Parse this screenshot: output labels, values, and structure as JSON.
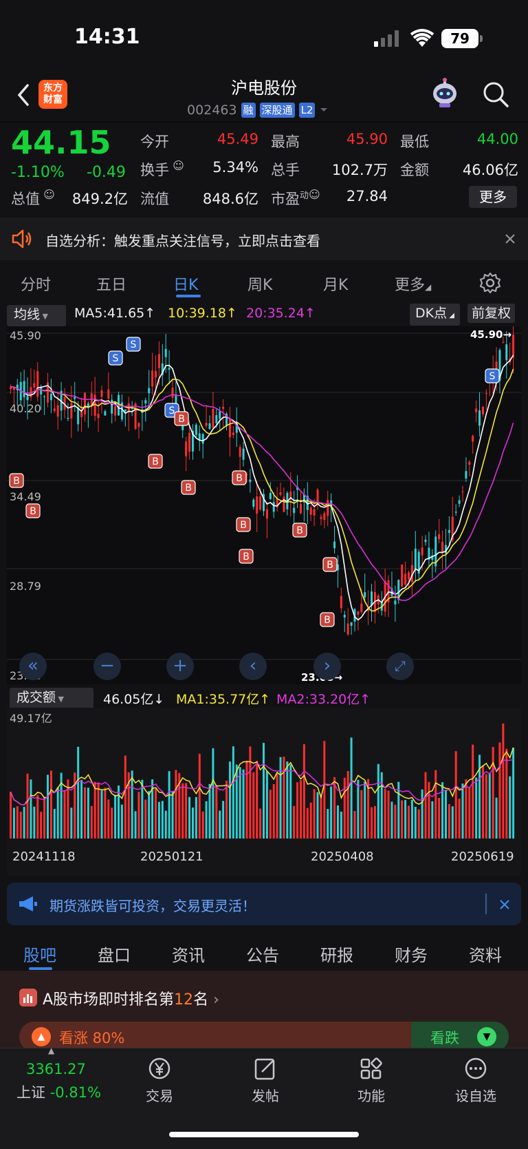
{
  "status": {
    "time": "14:31",
    "battery": "79"
  },
  "header": {
    "title": "沪电股份",
    "code": "002463",
    "logo_line1": "东方",
    "logo_line2": "财富",
    "tags": [
      "融",
      "深股通",
      "L2"
    ]
  },
  "quote": {
    "price": "44.15",
    "pct": "-1.10%",
    "chg": "-0.49",
    "labels": {
      "open": "今开",
      "high": "最高",
      "low": "最低",
      "turnover": "换手",
      "volume": "总手",
      "amount": "金额",
      "mktcap": "总值",
      "float_cap": "流值",
      "pe": "市盈"
    },
    "values": {
      "open": "45.49",
      "high": "45.90",
      "low": "44.00",
      "turnover": "5.34%",
      "volume": "102.7万",
      "amount": "46.06亿",
      "mktcap": "849.2亿",
      "float_cap": "848.6亿",
      "pe": "27.84"
    },
    "pe_sup": "动",
    "more": "更多"
  },
  "notice": {
    "text": "自选分析：触发重点关注信号，立即点击查看"
  },
  "tabs": [
    "分时",
    "五日",
    "日K",
    "周K",
    "月K",
    "更多"
  ],
  "ma": {
    "selector": "均线",
    "ma5": "MA5:41.65↑",
    "ma10": "10:39.18↑",
    "ma20": "20:35.24↑",
    "dk": "DK点",
    "adj": "前复权"
  },
  "kchart": {
    "y_labels": [
      "45.90",
      "40.20",
      "34.49",
      "28.79",
      "23.08"
    ],
    "high_marker": "45.90→",
    "low_marker": "23.08→",
    "colors": {
      "up": "#ff2e2e",
      "down": "#2fd0d4",
      "ma5": "#ffffff",
      "ma10": "#f5e63a",
      "ma20": "#d82fd8"
    }
  },
  "volume": {
    "selector": "成交额",
    "current": "46.05亿↓",
    "ma1": "MA1:35.77亿↑",
    "ma2": "MA2:33.20亿↑",
    "max_label": "49.17亿",
    "dates": [
      "20241118",
      "20250121",
      "20250408",
      "20250619"
    ]
  },
  "banner": {
    "text": "期货涨跌皆可投资，交易更灵活！"
  },
  "bottom_tabs": [
    "股吧",
    "盘口",
    "资讯",
    "公告",
    "研报",
    "财务",
    "资料"
  ],
  "rank": {
    "prefix": "A股市场即时排名第",
    "num": "12",
    "suffix": "名",
    "bull": "看涨 80%",
    "bear": "看跌"
  },
  "bottom_nav": {
    "index_value": "3361.27",
    "index_name": "上证",
    "index_pct": "-0.81%",
    "items": [
      "交易",
      "发帖",
      "功能",
      "设自选"
    ]
  }
}
